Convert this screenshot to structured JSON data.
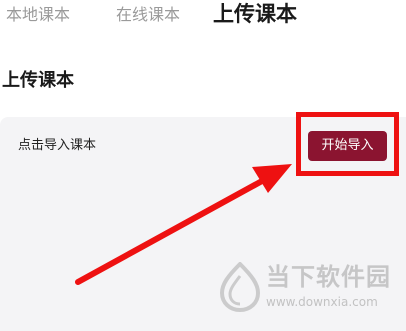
{
  "tabs": [
    {
      "label": "本地课本",
      "active": false
    },
    {
      "label": "在线课本",
      "active": false
    },
    {
      "label": "上传课本",
      "active": true
    }
  ],
  "section": {
    "title": "上传课本"
  },
  "card": {
    "label": "点击导入课本",
    "button_label": "开始导入"
  },
  "watermark": {
    "text": "当下软件园",
    "url": "www.downxia.com"
  },
  "colors": {
    "accent_button": "#8b1430",
    "annotation_red": "#ee1111",
    "card_bg": "#f4f4f6",
    "inactive_tab": "#9a9a9a"
  }
}
